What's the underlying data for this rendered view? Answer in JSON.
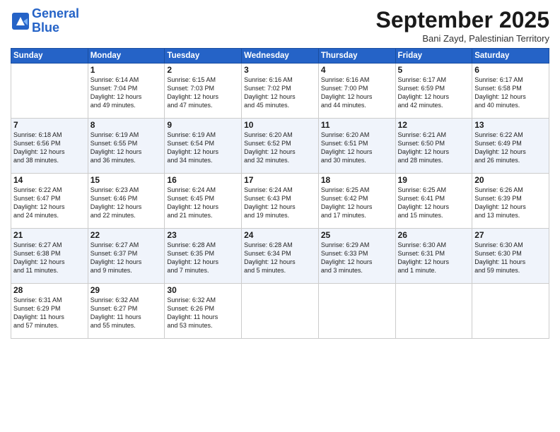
{
  "header": {
    "logo_line1": "General",
    "logo_line2": "Blue",
    "month": "September 2025",
    "location": "Bani Zayd, Palestinian Territory"
  },
  "weekdays": [
    "Sunday",
    "Monday",
    "Tuesday",
    "Wednesday",
    "Thursday",
    "Friday",
    "Saturday"
  ],
  "weeks": [
    [
      {
        "day": "",
        "text": ""
      },
      {
        "day": "1",
        "text": "Sunrise: 6:14 AM\nSunset: 7:04 PM\nDaylight: 12 hours\nand 49 minutes."
      },
      {
        "day": "2",
        "text": "Sunrise: 6:15 AM\nSunset: 7:03 PM\nDaylight: 12 hours\nand 47 minutes."
      },
      {
        "day": "3",
        "text": "Sunrise: 6:16 AM\nSunset: 7:02 PM\nDaylight: 12 hours\nand 45 minutes."
      },
      {
        "day": "4",
        "text": "Sunrise: 6:16 AM\nSunset: 7:00 PM\nDaylight: 12 hours\nand 44 minutes."
      },
      {
        "day": "5",
        "text": "Sunrise: 6:17 AM\nSunset: 6:59 PM\nDaylight: 12 hours\nand 42 minutes."
      },
      {
        "day": "6",
        "text": "Sunrise: 6:17 AM\nSunset: 6:58 PM\nDaylight: 12 hours\nand 40 minutes."
      }
    ],
    [
      {
        "day": "7",
        "text": "Sunrise: 6:18 AM\nSunset: 6:56 PM\nDaylight: 12 hours\nand 38 minutes."
      },
      {
        "day": "8",
        "text": "Sunrise: 6:19 AM\nSunset: 6:55 PM\nDaylight: 12 hours\nand 36 minutes."
      },
      {
        "day": "9",
        "text": "Sunrise: 6:19 AM\nSunset: 6:54 PM\nDaylight: 12 hours\nand 34 minutes."
      },
      {
        "day": "10",
        "text": "Sunrise: 6:20 AM\nSunset: 6:52 PM\nDaylight: 12 hours\nand 32 minutes."
      },
      {
        "day": "11",
        "text": "Sunrise: 6:20 AM\nSunset: 6:51 PM\nDaylight: 12 hours\nand 30 minutes."
      },
      {
        "day": "12",
        "text": "Sunrise: 6:21 AM\nSunset: 6:50 PM\nDaylight: 12 hours\nand 28 minutes."
      },
      {
        "day": "13",
        "text": "Sunrise: 6:22 AM\nSunset: 6:49 PM\nDaylight: 12 hours\nand 26 minutes."
      }
    ],
    [
      {
        "day": "14",
        "text": "Sunrise: 6:22 AM\nSunset: 6:47 PM\nDaylight: 12 hours\nand 24 minutes."
      },
      {
        "day": "15",
        "text": "Sunrise: 6:23 AM\nSunset: 6:46 PM\nDaylight: 12 hours\nand 22 minutes."
      },
      {
        "day": "16",
        "text": "Sunrise: 6:24 AM\nSunset: 6:45 PM\nDaylight: 12 hours\nand 21 minutes."
      },
      {
        "day": "17",
        "text": "Sunrise: 6:24 AM\nSunset: 6:43 PM\nDaylight: 12 hours\nand 19 minutes."
      },
      {
        "day": "18",
        "text": "Sunrise: 6:25 AM\nSunset: 6:42 PM\nDaylight: 12 hours\nand 17 minutes."
      },
      {
        "day": "19",
        "text": "Sunrise: 6:25 AM\nSunset: 6:41 PM\nDaylight: 12 hours\nand 15 minutes."
      },
      {
        "day": "20",
        "text": "Sunrise: 6:26 AM\nSunset: 6:39 PM\nDaylight: 12 hours\nand 13 minutes."
      }
    ],
    [
      {
        "day": "21",
        "text": "Sunrise: 6:27 AM\nSunset: 6:38 PM\nDaylight: 12 hours\nand 11 minutes."
      },
      {
        "day": "22",
        "text": "Sunrise: 6:27 AM\nSunset: 6:37 PM\nDaylight: 12 hours\nand 9 minutes."
      },
      {
        "day": "23",
        "text": "Sunrise: 6:28 AM\nSunset: 6:35 PM\nDaylight: 12 hours\nand 7 minutes."
      },
      {
        "day": "24",
        "text": "Sunrise: 6:28 AM\nSunset: 6:34 PM\nDaylight: 12 hours\nand 5 minutes."
      },
      {
        "day": "25",
        "text": "Sunrise: 6:29 AM\nSunset: 6:33 PM\nDaylight: 12 hours\nand 3 minutes."
      },
      {
        "day": "26",
        "text": "Sunrise: 6:30 AM\nSunset: 6:31 PM\nDaylight: 12 hours\nand 1 minute."
      },
      {
        "day": "27",
        "text": "Sunrise: 6:30 AM\nSunset: 6:30 PM\nDaylight: 11 hours\nand 59 minutes."
      }
    ],
    [
      {
        "day": "28",
        "text": "Sunrise: 6:31 AM\nSunset: 6:29 PM\nDaylight: 11 hours\nand 57 minutes."
      },
      {
        "day": "29",
        "text": "Sunrise: 6:32 AM\nSunset: 6:27 PM\nDaylight: 11 hours\nand 55 minutes."
      },
      {
        "day": "30",
        "text": "Sunrise: 6:32 AM\nSunset: 6:26 PM\nDaylight: 11 hours\nand 53 minutes."
      },
      {
        "day": "",
        "text": ""
      },
      {
        "day": "",
        "text": ""
      },
      {
        "day": "",
        "text": ""
      },
      {
        "day": "",
        "text": ""
      }
    ]
  ]
}
